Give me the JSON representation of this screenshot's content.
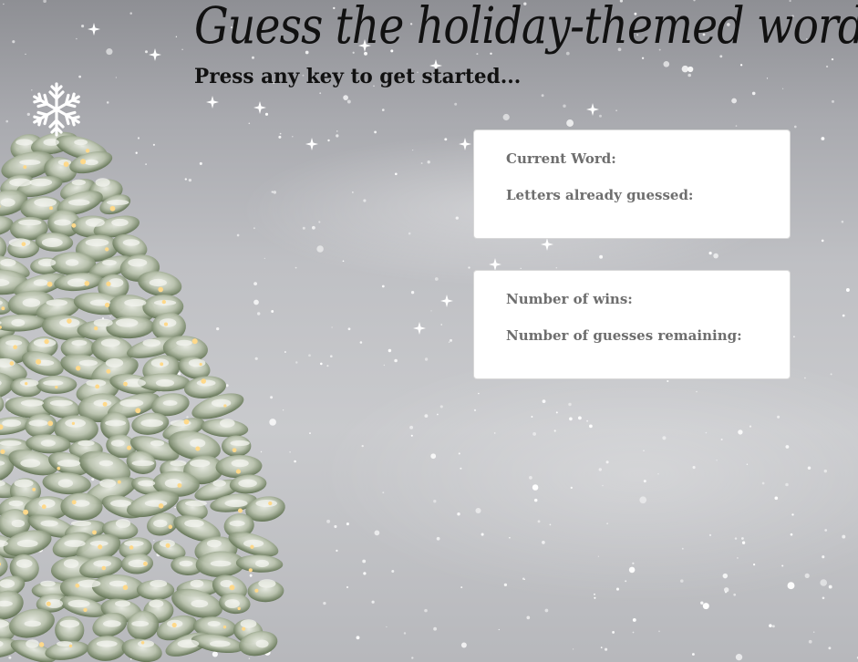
{
  "header": {
    "title": "Guess the holiday-themed word",
    "subtitle": "Press any key to get started..."
  },
  "word_card": {
    "current_word_label": "Current Word:",
    "current_word_value": "",
    "letters_guessed_label": "Letters already guessed:",
    "letters_guessed_value": ""
  },
  "stats_card": {
    "wins_label": "Number of wins:",
    "wins_value": "",
    "guesses_remaining_label": "Number of guesses remaining:",
    "guesses_remaining_value": ""
  },
  "decor": {
    "snowflake_icon": "snowflake-icon",
    "background_image": "snowy-christmas-tree-background",
    "colors": {
      "card_bg": "#ffffff",
      "label_text": "#6e6e6e",
      "title_text": "#111111"
    }
  }
}
